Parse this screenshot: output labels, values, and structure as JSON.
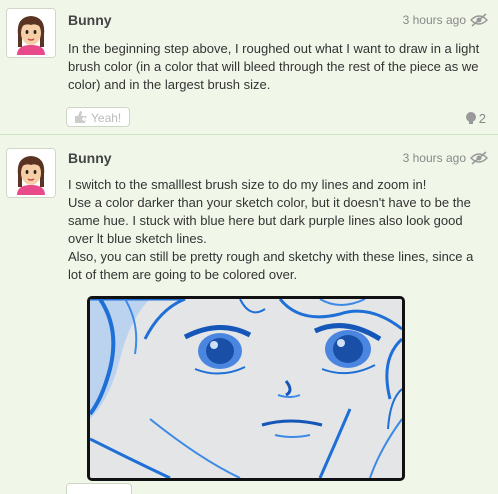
{
  "posts": [
    {
      "user": "Bunny",
      "time": "3 hours ago",
      "body": "In the beginning step above, I roughed out what I want to draw in a light brush color (in a color that will bleed through the rest of the piece as we color) and in the largest brush size.",
      "yeah_label": "Yeah!",
      "comments": "2"
    },
    {
      "user": "Bunny",
      "time": "3 hours ago",
      "body": "I switch to the smalllest brush size to do my lines and zoom in!\nUse a color darker than your sketch color, but it doesn't have to be the same hue.  I stuck with blue here but dark purple lines also look good over lt blue sketch lines.\nAlso, you can still be pretty rough and sketchy with these lines, since a lot of them are going to be colored over."
    }
  ],
  "icons": {
    "yeah": "yeah-hand-icon",
    "comment": "comment-bubble-icon",
    "visibility": "eye-icon"
  },
  "colors": {
    "background": "#f0f7e9",
    "sketch_blue": "#1e6fd6"
  }
}
